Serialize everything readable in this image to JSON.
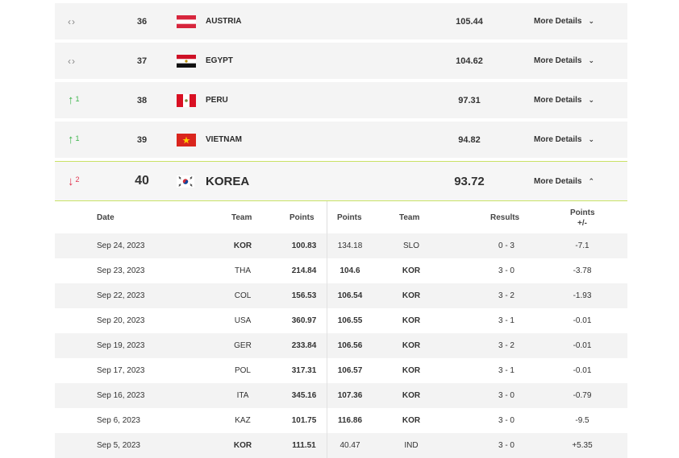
{
  "ranking_rows": [
    {
      "trend": "same",
      "trend_symbol": "‹›",
      "delta": "",
      "rank": "36",
      "flag": "austria",
      "country": "AUSTRIA",
      "points": "105.44",
      "details_label": "More Details"
    },
    {
      "trend": "same",
      "trend_symbol": "‹›",
      "delta": "",
      "rank": "37",
      "flag": "egypt",
      "country": "EGYPT",
      "points": "104.62",
      "details_label": "More Details"
    },
    {
      "trend": "up",
      "trend_symbol": "↑",
      "delta": "1",
      "rank": "38",
      "flag": "peru",
      "country": "PERU",
      "points": "97.31",
      "details_label": "More Details"
    },
    {
      "trend": "up",
      "trend_symbol": "↑",
      "delta": "1",
      "rank": "39",
      "flag": "vietnam",
      "country": "VIETNAM",
      "points": "94.82",
      "details_label": "More Details"
    },
    {
      "trend": "down",
      "trend_symbol": "↓",
      "delta": "2",
      "rank": "40",
      "flag": "korea",
      "country": "KOREA",
      "points": "93.72",
      "details_label": "More Details"
    }
  ],
  "details_table": {
    "headers": {
      "date": "Date",
      "team": "Team",
      "points": "Points",
      "opp_points": "Points",
      "opp_team": "Team",
      "results": "Results",
      "change": "Points",
      "change_sub": "+/-"
    },
    "rows": [
      {
        "date": "Sep 24, 2023",
        "team": "KOR",
        "points": "100.83",
        "opp_points": "134.18",
        "opp_team": "SLO",
        "result": "0 - 3",
        "change": "-7.1",
        "home": true
      },
      {
        "date": "Sep 23, 2023",
        "team": "THA",
        "points": "214.84",
        "opp_points": "104.6",
        "opp_team": "KOR",
        "result": "3 - 0",
        "change": "-3.78",
        "home": false
      },
      {
        "date": "Sep 22, 2023",
        "team": "COL",
        "points": "156.53",
        "opp_points": "106.54",
        "opp_team": "KOR",
        "result": "3 - 2",
        "change": "-1.93",
        "home": false
      },
      {
        "date": "Sep 20, 2023",
        "team": "USA",
        "points": "360.97",
        "opp_points": "106.55",
        "opp_team": "KOR",
        "result": "3 - 1",
        "change": "-0.01",
        "home": false
      },
      {
        "date": "Sep 19, 2023",
        "team": "GER",
        "points": "233.84",
        "opp_points": "106.56",
        "opp_team": "KOR",
        "result": "3 - 2",
        "change": "-0.01",
        "home": false
      },
      {
        "date": "Sep 17, 2023",
        "team": "POL",
        "points": "317.31",
        "opp_points": "106.57",
        "opp_team": "KOR",
        "result": "3 - 1",
        "change": "-0.01",
        "home": false
      },
      {
        "date": "Sep 16, 2023",
        "team": "ITA",
        "points": "345.16",
        "opp_points": "107.36",
        "opp_team": "KOR",
        "result": "3 - 0",
        "change": "-0.79",
        "home": false
      },
      {
        "date": "Sep 6, 2023",
        "team": "KAZ",
        "points": "101.75",
        "opp_points": "116.86",
        "opp_team": "KOR",
        "result": "3 - 0",
        "change": "-9.5",
        "home": false
      },
      {
        "date": "Sep 5, 2023",
        "team": "KOR",
        "points": "111.51",
        "opp_points": "40.47",
        "opp_team": "IND",
        "result": "3 - 0",
        "change": "+5.35",
        "home": true
      }
    ]
  }
}
